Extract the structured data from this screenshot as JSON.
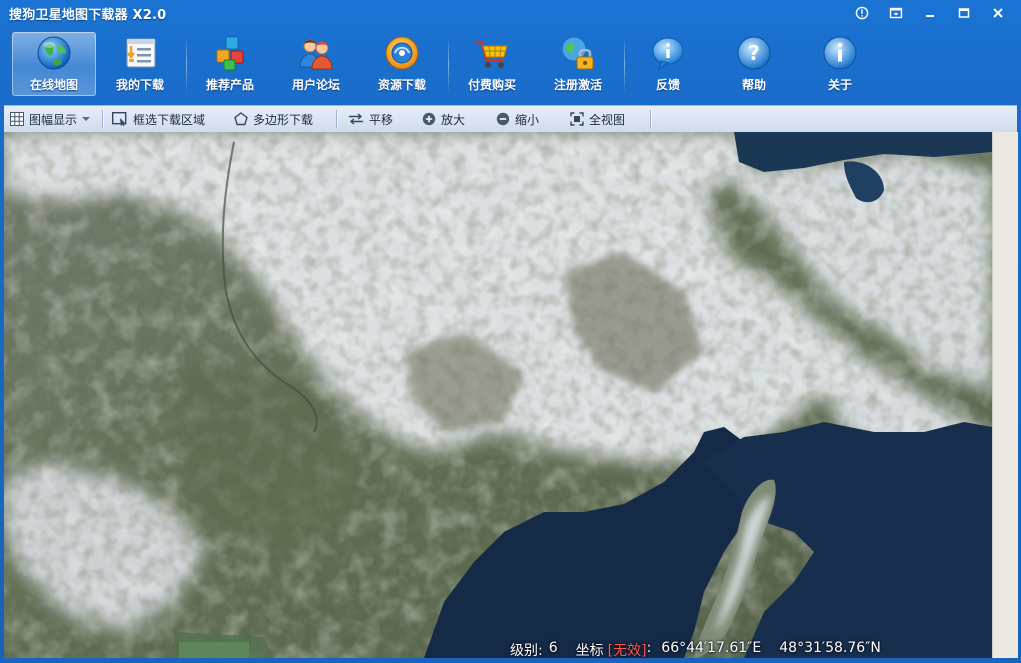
{
  "window": {
    "title": "搜狗卫星地图下载器 X2.0"
  },
  "toolbar": {
    "items": [
      {
        "label": "在线地图",
        "icon": "globe-icon",
        "active": true
      },
      {
        "label": "我的下载",
        "icon": "download-list-icon"
      },
      {
        "label": "推荐产品",
        "icon": "cubes-icon"
      },
      {
        "label": "用户论坛",
        "icon": "users-icon"
      },
      {
        "label": "资源下载",
        "icon": "resource-disc-icon"
      },
      {
        "label": "付费购买",
        "icon": "shopping-cart-icon"
      },
      {
        "label": "注册激活",
        "icon": "register-lock-icon"
      },
      {
        "label": "反馈",
        "icon": "feedback-bubble-icon"
      },
      {
        "label": "帮助",
        "icon": "help-icon"
      },
      {
        "label": "关于",
        "icon": "info-icon"
      }
    ]
  },
  "mapbar": {
    "items": [
      {
        "label": "图幅显示",
        "icon": "grid-icon",
        "dropdown": true
      },
      {
        "label": "框选下载区域",
        "icon": "select-rect-icon"
      },
      {
        "label": "多边形下载",
        "icon": "polygon-icon"
      },
      {
        "label": "平移",
        "icon": "pan-icon"
      },
      {
        "label": "放大",
        "icon": "zoom-in-icon"
      },
      {
        "label": "缩小",
        "icon": "zoom-out-icon"
      },
      {
        "label": "全视图",
        "icon": "full-view-icon"
      }
    ]
  },
  "status": {
    "level_label": "级别:",
    "level_value": "6",
    "coord_label": "坐标",
    "coord_invalid": "[无效]",
    "coord_colon": ":",
    "longitude": "66°44′17.61″E",
    "latitude": "48°31′58.76″N"
  },
  "colors": {
    "titlebar": "#1a73d3",
    "mapbar": "#dbe5f2",
    "invalid": "#ff5a4a",
    "water": "#0d2340",
    "land": "#5e6b50",
    "snow": "#e9edf1"
  }
}
